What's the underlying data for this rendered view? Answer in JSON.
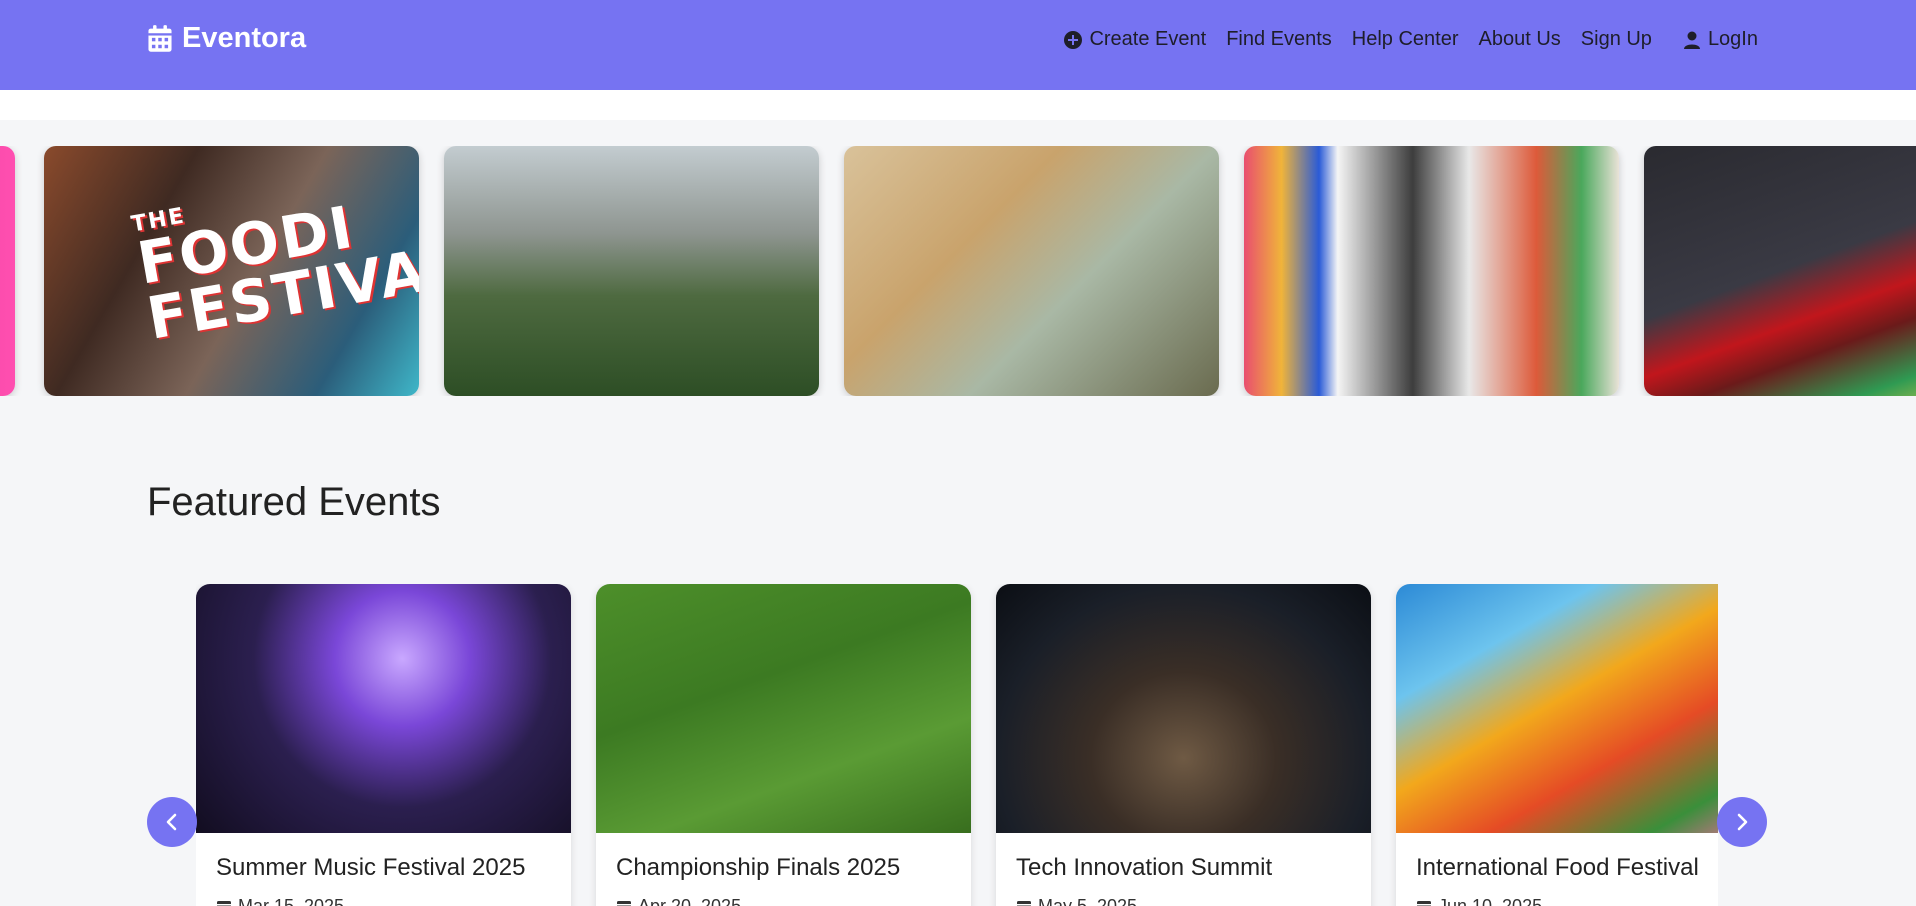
{
  "brand": {
    "name": "Eventora",
    "icon": "calendar-icon"
  },
  "nav": {
    "create_event": "Create Event",
    "find_events": "Find Events",
    "help_center": "Help Center",
    "about_us": "About Us",
    "sign_up": "Sign Up",
    "login": "LogIn"
  },
  "hero": {
    "cards": [
      {
        "name": "partial-pink-banner"
      },
      {
        "name": "foodi-festival",
        "title_small": "THE",
        "title_line1": "FOODI",
        "title_line2": "FESTIVAL"
      },
      {
        "name": "hiking-adventure"
      },
      {
        "name": "classroom-workshop"
      },
      {
        "name": "art-exhibition"
      },
      {
        "name": "motor-racing"
      }
    ]
  },
  "featured": {
    "heading": "Featured Events",
    "events": [
      {
        "title": "Summer Music Festival 2025",
        "date": "Mar 15, 2025"
      },
      {
        "title": "Championship Finals 2025",
        "date": "Apr 20, 2025"
      },
      {
        "title": "Tech Innovation Summit",
        "date": "May 5, 2025"
      },
      {
        "title": "International Food Festival",
        "date": "Jun 10, 2025"
      }
    ],
    "prev_icon": "chevron-left-icon",
    "next_icon": "chevron-right-icon"
  },
  "colors": {
    "primary": "#7673f2",
    "page_bg": "#f5f6f8"
  }
}
